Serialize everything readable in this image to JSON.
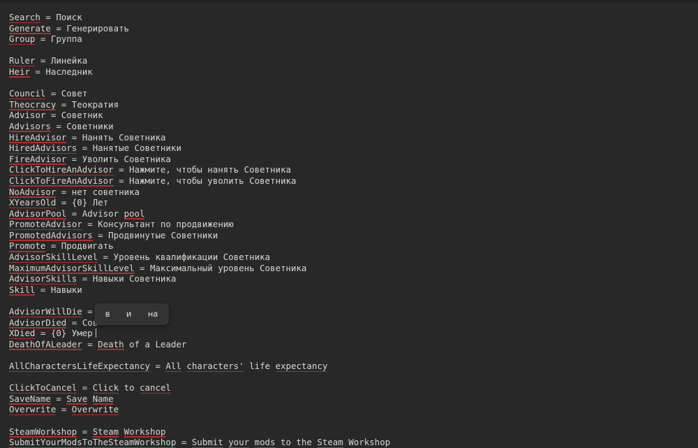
{
  "window": {
    "background_color": "#282828",
    "text_color": "#d7d7d2",
    "spellcheck_underline_color": "#bb2b2b",
    "top_strip_color": "#222222"
  },
  "editor": {
    "lines": [
      {
        "segments": [
          {
            "t": "Search",
            "sp": true
          },
          {
            "t": " = Поиск",
            "sp": false
          }
        ]
      },
      {
        "segments": [
          {
            "t": "Generate",
            "sp": true
          },
          {
            "t": " = Генерировать",
            "sp": false
          }
        ]
      },
      {
        "segments": [
          {
            "t": "Group",
            "sp": true
          },
          {
            "t": " = Группа",
            "sp": false
          }
        ]
      },
      {
        "segments": []
      },
      {
        "segments": [
          {
            "t": "Ruler",
            "sp": true
          },
          {
            "t": " = Линейка",
            "sp": false
          }
        ]
      },
      {
        "segments": [
          {
            "t": "Heir",
            "sp": true
          },
          {
            "t": " = Наследник",
            "sp": false
          }
        ]
      },
      {
        "segments": []
      },
      {
        "segments": [
          {
            "t": "Council",
            "sp": true
          },
          {
            "t": " = Совет",
            "sp": false
          }
        ]
      },
      {
        "segments": [
          {
            "t": "Theocracy",
            "sp": true
          },
          {
            "t": " = Теократия",
            "sp": false
          }
        ]
      },
      {
        "segments": [
          {
            "t": "Advisor = Советник",
            "sp": false
          }
        ]
      },
      {
        "segments": [
          {
            "t": "Advisors",
            "sp": true
          },
          {
            "t": " = Советники",
            "sp": false
          }
        ]
      },
      {
        "segments": [
          {
            "t": "HireAdvisor",
            "sp": true
          },
          {
            "t": " = Нанять Советника",
            "sp": false
          }
        ]
      },
      {
        "segments": [
          {
            "t": "HiredAdvisors",
            "sp": true
          },
          {
            "t": " = Нанятые Советники",
            "sp": false
          }
        ]
      },
      {
        "segments": [
          {
            "t": "FireAdvisor",
            "sp": true
          },
          {
            "t": " = Уволить Советника",
            "sp": false
          }
        ]
      },
      {
        "segments": [
          {
            "t": "ClickToHireAnAdvisor",
            "sp": true
          },
          {
            "t": " = Нажмите, чтобы нанять Советника",
            "sp": false
          }
        ]
      },
      {
        "segments": [
          {
            "t": "ClickToFireAnAdvisor",
            "sp": true
          },
          {
            "t": " = Нажмите, чтобы уволить Советника",
            "sp": false
          }
        ]
      },
      {
        "segments": [
          {
            "t": "NoAdvisor",
            "sp": true
          },
          {
            "t": " = нет советника",
            "sp": false
          }
        ]
      },
      {
        "segments": [
          {
            "t": "XYearsOld",
            "sp": true
          },
          {
            "t": " = {0} Лет",
            "sp": false
          }
        ]
      },
      {
        "segments": [
          {
            "t": "AdvisorPool",
            "sp": true
          },
          {
            "t": " = Advisor ",
            "sp": false
          },
          {
            "t": "pool",
            "sp": true
          }
        ]
      },
      {
        "segments": [
          {
            "t": "PromoteAdvisor",
            "sp": true
          },
          {
            "t": " = Консультант по продвижению",
            "sp": false
          }
        ]
      },
      {
        "segments": [
          {
            "t": "PromotedAdvisors",
            "sp": true
          },
          {
            "t": " = Продвинутые Советники",
            "sp": false
          }
        ]
      },
      {
        "segments": [
          {
            "t": "Promote",
            "sp": true
          },
          {
            "t": " = Продвигать",
            "sp": false
          }
        ]
      },
      {
        "segments": [
          {
            "t": "AdvisorSkillLevel",
            "sp": true
          },
          {
            "t": " = Уровень квалификации Советника",
            "sp": false
          }
        ]
      },
      {
        "segments": [
          {
            "t": "MaximumAdvisorSkillLevel",
            "sp": true
          },
          {
            "t": " = Максимальный уровень Советника",
            "sp": false
          }
        ]
      },
      {
        "segments": [
          {
            "t": "AdvisorSkills",
            "sp": true
          },
          {
            "t": " = Навыки Советника",
            "sp": false
          }
        ]
      },
      {
        "segments": [
          {
            "t": "Skill",
            "sp": true
          },
          {
            "t": " = Навыки",
            "sp": false
          }
        ]
      },
      {
        "segments": []
      },
      {
        "segments": [
          {
            "t": "AdvisorWillDie",
            "sp": true
          },
          {
            "t": " =",
            "sp": false
          }
        ]
      },
      {
        "segments": [
          {
            "t": "AdvisorDied",
            "sp": true
          },
          {
            "t": " = Сов",
            "sp": false
          }
        ]
      },
      {
        "segments": [
          {
            "t": "XDied",
            "sp": true
          },
          {
            "t": " = {0} Умер",
            "sp": false
          }
        ],
        "caret": true
      },
      {
        "segments": [
          {
            "t": "DeathOfALeader",
            "sp": true
          },
          {
            "t": " = ",
            "sp": false
          },
          {
            "t": "Death",
            "sp": true
          },
          {
            "t": " of a Leader",
            "sp": false
          }
        ]
      },
      {
        "segments": []
      },
      {
        "segments": [
          {
            "t": "AllCharactersLifeExpectancy",
            "sp": true
          },
          {
            "t": " = ",
            "sp": false
          },
          {
            "t": "All",
            "sp": true
          },
          {
            "t": " ",
            "sp": false
          },
          {
            "t": "characters'",
            "sp": true
          },
          {
            "t": " life ",
            "sp": false
          },
          {
            "t": "expectancy",
            "sp": true
          }
        ]
      },
      {
        "segments": []
      },
      {
        "segments": [
          {
            "t": "ClickToCancel",
            "sp": true
          },
          {
            "t": " = ",
            "sp": false
          },
          {
            "t": "Click",
            "sp": true
          },
          {
            "t": " to ",
            "sp": false
          },
          {
            "t": "cancel",
            "sp": true
          }
        ]
      },
      {
        "segments": [
          {
            "t": "SaveName",
            "sp": true
          },
          {
            "t": " = ",
            "sp": false
          },
          {
            "t": "Save",
            "sp": true
          },
          {
            "t": " ",
            "sp": false
          },
          {
            "t": "Name",
            "sp": true
          }
        ]
      },
      {
        "segments": [
          {
            "t": "Overwrite",
            "sp": true
          },
          {
            "t": " = ",
            "sp": false
          },
          {
            "t": "Overwrite",
            "sp": true
          }
        ]
      },
      {
        "segments": []
      },
      {
        "segments": [
          {
            "t": "SteamWorkshop",
            "sp": true
          },
          {
            "t": " = ",
            "sp": false
          },
          {
            "t": "Steam",
            "sp": true
          },
          {
            "t": " ",
            "sp": false
          },
          {
            "t": "Workshop",
            "sp": true
          }
        ]
      },
      {
        "segments": [
          {
            "t": "SubmitYourModsToTheSteamWorkshop",
            "sp": true
          },
          {
            "t": " = ",
            "sp": false
          },
          {
            "t": "Submit",
            "sp": true
          },
          {
            "t": " ",
            "sp": false
          },
          {
            "t": "your",
            "sp": true
          },
          {
            "t": " ",
            "sp": false
          },
          {
            "t": "mods",
            "sp": true
          },
          {
            "t": " to the ",
            "sp": false
          },
          {
            "t": "Steam",
            "sp": true
          },
          {
            "t": " Workshop",
            "sp": false
          }
        ]
      }
    ]
  },
  "ime_popup": {
    "visible": true,
    "background_color": "#333333",
    "suggestions": [
      "в",
      "и",
      "на"
    ]
  }
}
